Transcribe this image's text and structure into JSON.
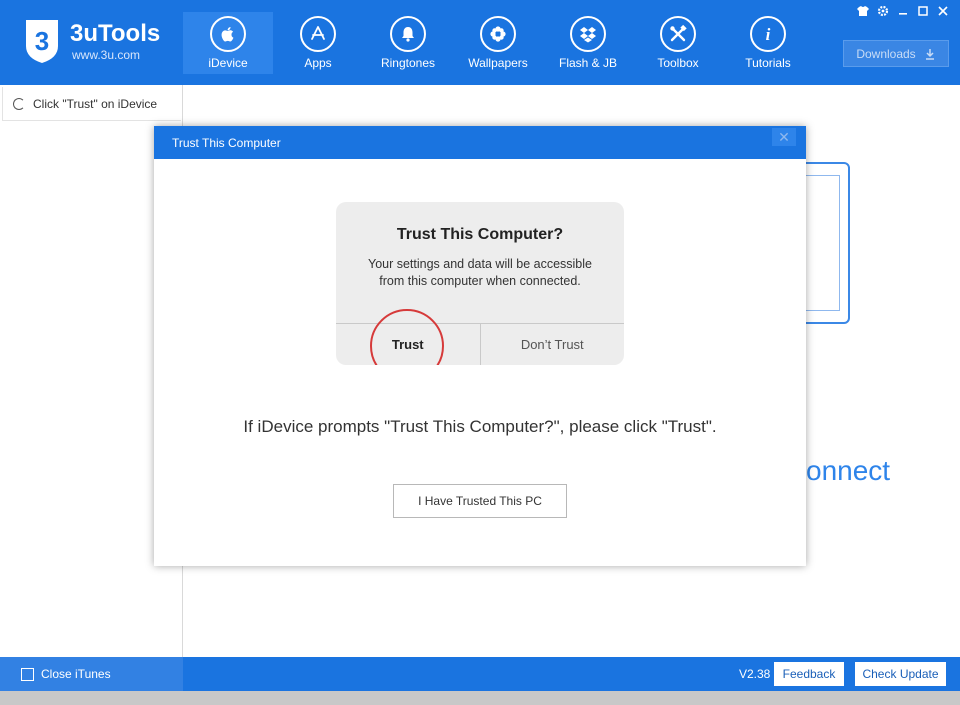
{
  "app": {
    "name": "3uTools",
    "url": "www.3u.com",
    "logo_char": "3"
  },
  "nav": {
    "items": [
      {
        "label": "iDevice",
        "icon": "apple-icon"
      },
      {
        "label": "Apps",
        "icon": "appstore-icon"
      },
      {
        "label": "Ringtones",
        "icon": "bell-icon"
      },
      {
        "label": "Wallpapers",
        "icon": "flower-icon"
      },
      {
        "label": "Flash & JB",
        "icon": "dropbox-icon"
      },
      {
        "label": "Toolbox",
        "icon": "tools-icon"
      },
      {
        "label": "Tutorials",
        "icon": "info-icon"
      }
    ],
    "active_index": 0
  },
  "toolbar": {
    "downloads_label": "Downloads"
  },
  "sidebar": {
    "status_label": "Click \"Trust\" on iDevice"
  },
  "background": {
    "connect_text": "onnect"
  },
  "modal": {
    "title": "Trust This Computer",
    "close_glyph": "✕",
    "alert": {
      "title": "Trust This Computer?",
      "message": "Your settings and data will be accessible from this computer when connected.",
      "trust_label": "Trust",
      "dont_trust_label": "Don’t Trust"
    },
    "instruction": "If iDevice prompts \"Trust This Computer?\", please click \"Trust\".",
    "confirm_label": "I Have Trusted This PC"
  },
  "footer": {
    "close_itunes_label": "Close iTunes",
    "version": "V2.38",
    "feedback_label": "Feedback",
    "check_update_label": "Check Update"
  },
  "colors": {
    "brand_blue": "#1a74e0",
    "highlight_red": "#d63a3a"
  }
}
